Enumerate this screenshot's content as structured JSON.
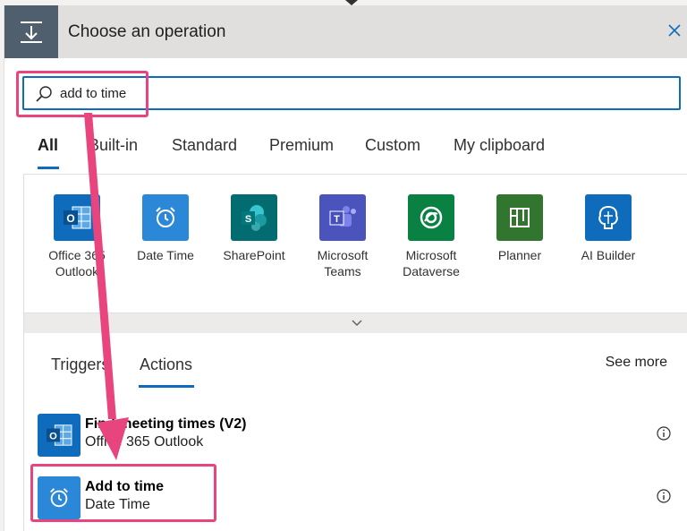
{
  "header": {
    "title": "Choose an operation",
    "icon": "insert-step-icon",
    "close_icon": "close-icon"
  },
  "search": {
    "value": "add to time",
    "icon": "search-icon"
  },
  "tabs": [
    {
      "label": "All",
      "active": true
    },
    {
      "label": "Built-in",
      "active": false
    },
    {
      "label": "Standard",
      "active": false
    },
    {
      "label": "Premium",
      "active": false
    },
    {
      "label": "Custom",
      "active": false
    },
    {
      "label": "My clipboard",
      "active": false
    }
  ],
  "connectors": [
    {
      "label": "Office 365 Outlook",
      "color": "#0f6cbd",
      "icon": "outlook-icon"
    },
    {
      "label": "Date Time",
      "color": "#2b88d8",
      "icon": "alarm-clock-icon"
    },
    {
      "label": "SharePoint",
      "color": "#036c70",
      "icon": "sharepoint-icon"
    },
    {
      "label": "Microsoft Teams",
      "color": "#4b53bc",
      "icon": "teams-icon"
    },
    {
      "label": "Microsoft Dataverse",
      "color": "#088142",
      "icon": "dataverse-icon"
    },
    {
      "label": "Planner",
      "color": "#31752f",
      "icon": "planner-icon"
    },
    {
      "label": "AI Builder",
      "color": "#0f6cbd",
      "icon": "ai-builder-icon"
    }
  ],
  "expand_icon": "chevron-down-icon",
  "sub_tabs": [
    {
      "label": "Triggers",
      "active": false
    },
    {
      "label": "Actions",
      "active": true
    }
  ],
  "see_more": "See more",
  "actions": [
    {
      "title": "Find meeting times (V2)",
      "subtitle": "Office 365 Outlook",
      "color": "#0f6cbd",
      "icon": "outlook-icon"
    },
    {
      "title": "Add to time",
      "subtitle": "Date Time",
      "color": "#2b88d8",
      "icon": "alarm-clock-icon"
    }
  ],
  "info_icon": "info-icon",
  "colors": {
    "accent": "#0f6cbd",
    "highlight": "#e8457f",
    "header_icon_bg": "#505f6e"
  }
}
